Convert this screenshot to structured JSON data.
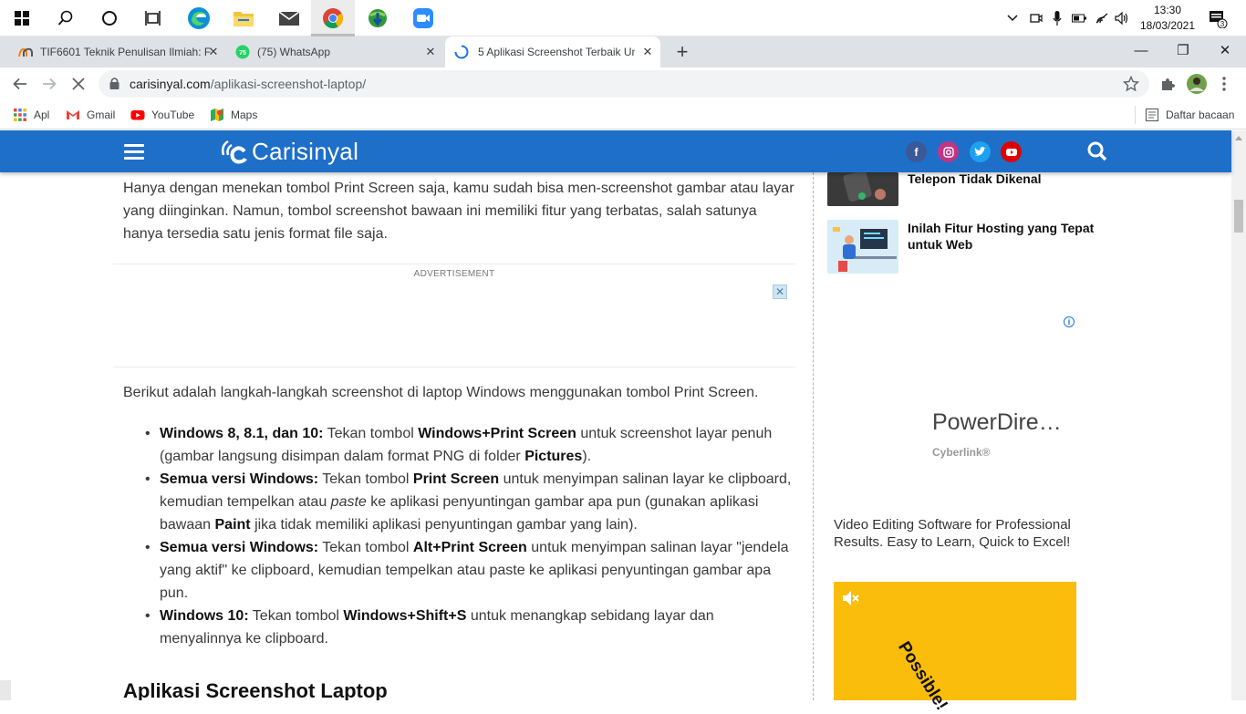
{
  "taskbar": {
    "icons": [
      "windows-icon",
      "search-icon",
      "cortana-icon",
      "task-view-icon",
      "edge-icon",
      "file-explorer-icon",
      "mail-icon",
      "chrome-icon",
      "internet-download-manager-icon",
      "zoom-icon"
    ],
    "time": "13:30",
    "date": "18/03/2021",
    "notification_count": "3"
  },
  "tabs": [
    {
      "title": "TIF6601 Teknik Penulisan Ilmiah: F",
      "active": false
    },
    {
      "title": "(75) WhatsApp",
      "active": false
    },
    {
      "title": "5 Aplikasi Screenshot Terbaik Unt",
      "active": true
    }
  ],
  "tab_close_glyph": "✕",
  "new_tab_glyph": "+",
  "window_controls": {
    "minimize": "—",
    "restore": "❐",
    "close": "✕"
  },
  "address": {
    "host": "carisinyal.com",
    "path": "/aplikasi-screenshot-laptop/"
  },
  "bookmarks": [
    {
      "label": "Apl",
      "icon": "apps-grid-icon"
    },
    {
      "label": "Gmail",
      "icon": "gmail-icon"
    },
    {
      "label": "YouTube",
      "icon": "youtube-icon"
    },
    {
      "label": "Maps",
      "icon": "maps-icon"
    }
  ],
  "reading_list": "Daftar bacaan",
  "site": {
    "logo": "Carisinyal",
    "social": [
      "facebook-icon",
      "instagram-icon",
      "twitter-icon",
      "youtube-icon"
    ],
    "colors": {
      "header": "#1e6fc8",
      "facebook": "#3b5998",
      "instagram": "#c13584",
      "twitter": "#1da1f2",
      "youtube": "#e00000"
    }
  },
  "article": {
    "intro": "Hanya dengan menekan tombol Print Screen saja, kamu sudah bisa men-screenshot gambar atau layar yang diinginkan. Namun, tombol screenshot bawaan ini memiliki fitur yang terbatas, salah satunya hanya tersedia satu jenis format file saja.",
    "ad_label": "ADVERTISEMENT",
    "steps_intro": "Berikut adalah langkah-langkah screenshot di laptop Windows menggunakan tombol Print Screen.",
    "steps": [
      {
        "a": "Windows 8, 8.1, dan 10:",
        "b": " Tekan tombol ",
        "c": "Windows+Print Screen",
        "d": " untuk screenshot layar penuh (gambar langsung disimpan dalam format PNG di folder ",
        "e": "Pictures",
        "f": ")."
      },
      {
        "a": "Semua versi Windows:",
        "b": " Tekan tombol ",
        "c": "Print Screen",
        "d": " untuk menyimpan salinan layar ke clipboard, kemudian tempelkan atau ",
        "e": "paste",
        "f": " ke aplikasi penyuntingan gambar apa pun (gunakan aplikasi bawaan ",
        "g": "Paint",
        "h": " jika tidak memiliki aplikasi penyuntingan gambar yang lain)."
      },
      {
        "a": "Semua versi Windows:",
        "b": " Tekan tombol ",
        "c": "Alt+Print Screen",
        "d": " untuk menyimpan salinan layar \"jendela yang aktif\" ke clipboard, kemudian tempelkan atau paste ke aplikasi penyuntingan gambar apa pun."
      },
      {
        "a": "Windows 10:",
        "b": " Tekan tombol ",
        "c": "Windows+Shift+S",
        "d": " untuk menangkap sebidang layar dan menyalinnya ke clipboard."
      }
    ],
    "heading": "Aplikasi Screenshot Laptop"
  },
  "sidebar": {
    "related": [
      {
        "title": "Telepon Tidak Dikenal"
      },
      {
        "title": "Inilah Fitur Hosting yang Tepat untuk Web"
      }
    ],
    "ad": {
      "title": "PowerDire…",
      "brand": "Cyberlink®",
      "description": "Video Editing Software for Professional Results. Easy to Learn, Quick to Excel!",
      "video_text": "Possible!"
    }
  }
}
